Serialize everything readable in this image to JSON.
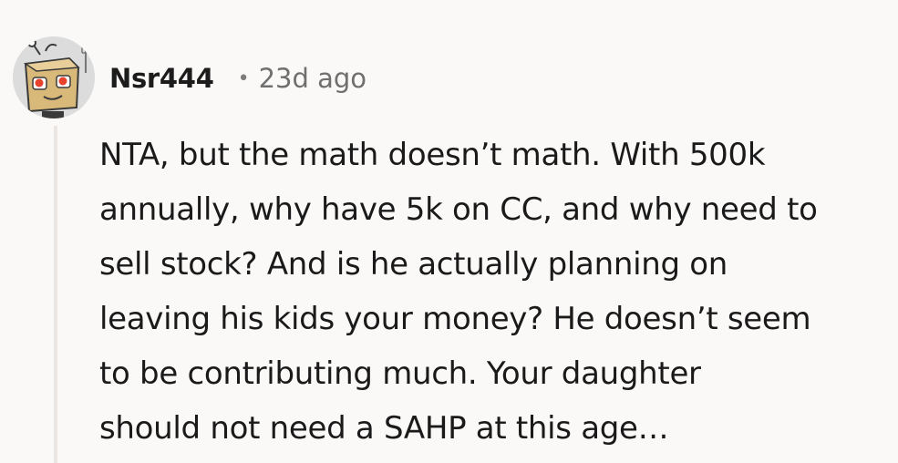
{
  "comment": {
    "username": "Nsr444",
    "separator": "•",
    "timestamp": "23d ago",
    "body": "NTA, but the math doesn’t math. With 500k\nannually, why have 5k on CC, and why need to\nsell stock? And is he actually planning on\nleaving his kids your money? He doesn’t seem\nto be contributing much. Your daughter\nshould not need a SAHP at this age…"
  },
  "avatar": {
    "icon": "snoo-box-costume-avatar-icon",
    "colors": {
      "background": "#dcdcdc",
      "box": "#d9b97a",
      "eyes": "#e8412c",
      "outline": "#3a3a3a"
    }
  }
}
